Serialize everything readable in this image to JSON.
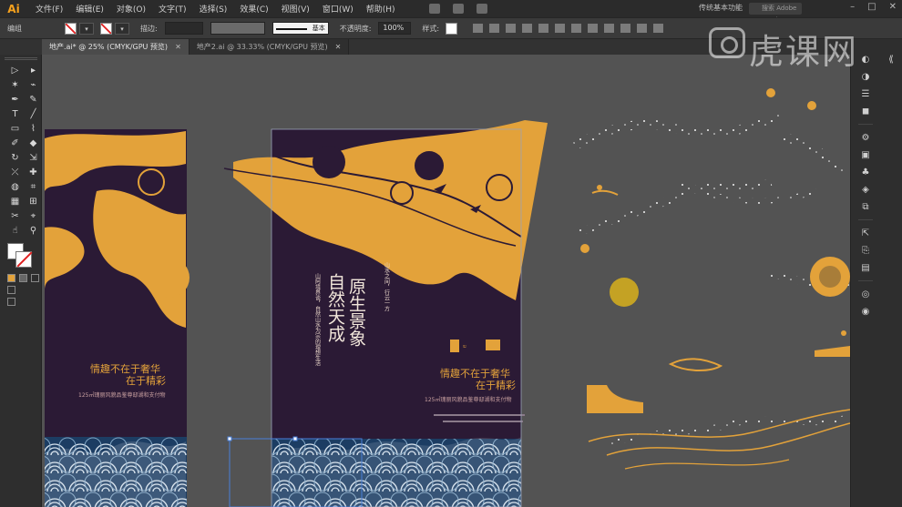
{
  "menu": {
    "logo": "Ai",
    "items": [
      "文件(F)",
      "编辑(E)",
      "对象(O)",
      "文字(T)",
      "选择(S)",
      "效果(C)",
      "视图(V)",
      "窗口(W)",
      "帮助(H)"
    ],
    "workspace": "传统基本功能",
    "search_placeholder": "搜索 Adobe Stock"
  },
  "control": {
    "selection_label": "编组",
    "stroke_label": "描边:",
    "stroke_profile": "基本",
    "opacity_label": "不透明度:",
    "opacity_value": "100%",
    "style_label": "样式:"
  },
  "tabs": [
    {
      "label": "地产.ai* @ 25% (CMYK/GPU 预览)",
      "active": true
    },
    {
      "label": "地产2.ai @ 33.33% (CMYK/GPU 预览)",
      "active": false
    }
  ],
  "tools": [
    "▷",
    "▸",
    "✶",
    "⌁",
    "✒",
    "✎",
    "T",
    "╱",
    "▭",
    "⌇",
    "✐",
    "◆",
    "↻",
    "⇲",
    "⤫",
    "✚",
    "◍",
    "⌗",
    "▦",
    "⊞",
    "✂",
    "⌖",
    "☝",
    "⚲"
  ],
  "dock_icons": [
    "◐",
    "◑",
    "☰",
    "◼",
    "⚙",
    "▣",
    "♣",
    "◈",
    "⧉",
    "⇱",
    "⎘",
    "▤",
    "◎",
    "◉"
  ],
  "poster": {
    "headline": "原生景象",
    "subline": "自然天成",
    "tagline1": "情趣不在于奢华",
    "tagline2": "在于精彩",
    "small_text": "125㎡瑰丽风貌品鉴尊邸湖和支付物",
    "vertical_left": "山阿境界谈，自然山水为宗的理想生活",
    "vertical_right": "山水之间，行云一方"
  },
  "colors": {
    "gold": "#E3A23A",
    "purple": "#2B1A35",
    "navy": "#1C3D63",
    "canvas": "#535353",
    "sun": "#C4A224"
  },
  "watermark": "虎课网"
}
